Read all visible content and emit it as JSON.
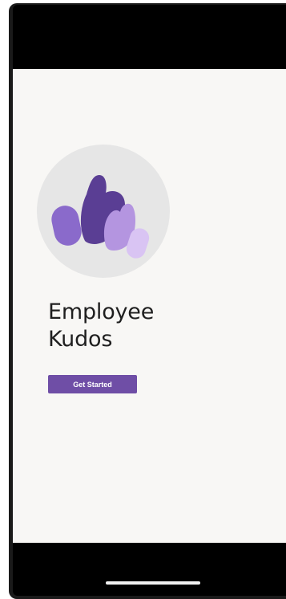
{
  "app": {
    "title_line1": "Employee",
    "title_line2": "Kudos"
  },
  "actions": {
    "get_started_label": "Get Started"
  },
  "hero": {
    "icon": "raised-hands-illustration"
  },
  "colors": {
    "accent": "#6f4ea6",
    "screen_background": "#f8f7f5",
    "hero_circle": "#e6e6e6",
    "device_bars": "#000000"
  }
}
